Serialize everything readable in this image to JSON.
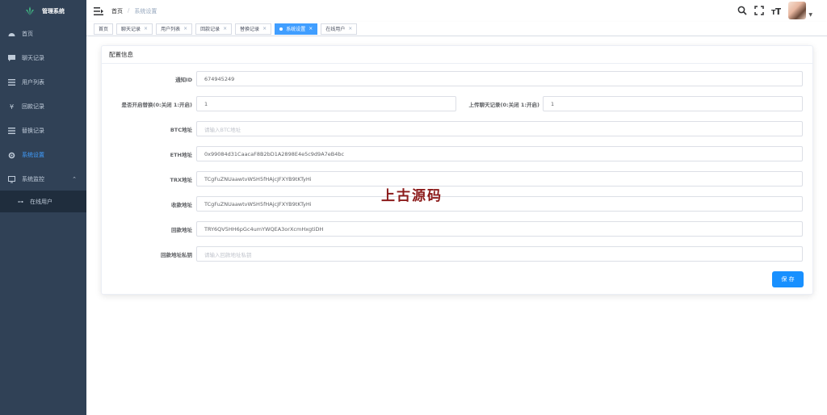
{
  "app": {
    "title": "管理系统"
  },
  "sidebar": {
    "items": [
      {
        "label": "首页",
        "icon": "dashboard-icon",
        "active": false
      },
      {
        "label": "聊天记录",
        "icon": "message-icon",
        "active": false
      },
      {
        "label": "用户列表",
        "icon": "list-icon",
        "active": false
      },
      {
        "label": "回款记录",
        "icon": "yen-icon",
        "active": false
      },
      {
        "label": "替换记录",
        "icon": "list-icon",
        "active": false
      },
      {
        "label": "系统设置",
        "icon": "gear-icon",
        "active": true
      },
      {
        "label": "系统监控",
        "icon": "monitor-icon",
        "active": false
      }
    ],
    "submenu": {
      "label": "在线用户",
      "icon": "online-icon"
    }
  },
  "navbar": {
    "breadcrumb": {
      "home": "首页",
      "separator": "/",
      "current": "系统设置"
    }
  },
  "tags": [
    {
      "label": "首页",
      "closable": false,
      "active": false
    },
    {
      "label": "聊天记录",
      "closable": true,
      "active": false
    },
    {
      "label": "用户列表",
      "closable": true,
      "active": false
    },
    {
      "label": "回款记录",
      "closable": true,
      "active": false
    },
    {
      "label": "替换记录",
      "closable": true,
      "active": false
    },
    {
      "label": "系统设置",
      "closable": true,
      "active": true
    },
    {
      "label": "在线用户",
      "closable": true,
      "active": false
    }
  ],
  "form": {
    "header": "配置信息",
    "notify_id": {
      "label": "通知ID",
      "value": "674945249"
    },
    "enable_replace": {
      "label": "是否开启替换(0:关闭 1:开启)",
      "value": "1"
    },
    "upload_chat": {
      "label": "上传聊天记录(0:关闭 1:开启)",
      "value": "1"
    },
    "btc": {
      "label": "BTC地址",
      "value": "",
      "placeholder": "请输入BTC地址"
    },
    "eth": {
      "label": "ETH地址",
      "value": "0x99084d31CaacaF8B2bD1A2898E4e5c9d9A7eB4bc"
    },
    "trx": {
      "label": "TRX地址",
      "value": "TCgFuZNUaawtvWSH5fHAjcJFXYB9tKTyHi"
    },
    "receive": {
      "label": "收款地址",
      "value": "TCgFuZNUaawtvWSH5fHAjcJFXYB9tKTyHi"
    },
    "return_addr": {
      "label": "回款地址",
      "value": "TRY6QV5HH6pGc4umYWQEA3orXcmHxgtiDH"
    },
    "return_key": {
      "label": "回款地址私钥",
      "value": "",
      "placeholder": "请输入回款地址私钥"
    },
    "save_label": "保 存"
  },
  "watermark": "上古源码",
  "colors": {
    "sidebar_bg": "#304156",
    "accent": "#409eff",
    "button": "#1890ff"
  }
}
